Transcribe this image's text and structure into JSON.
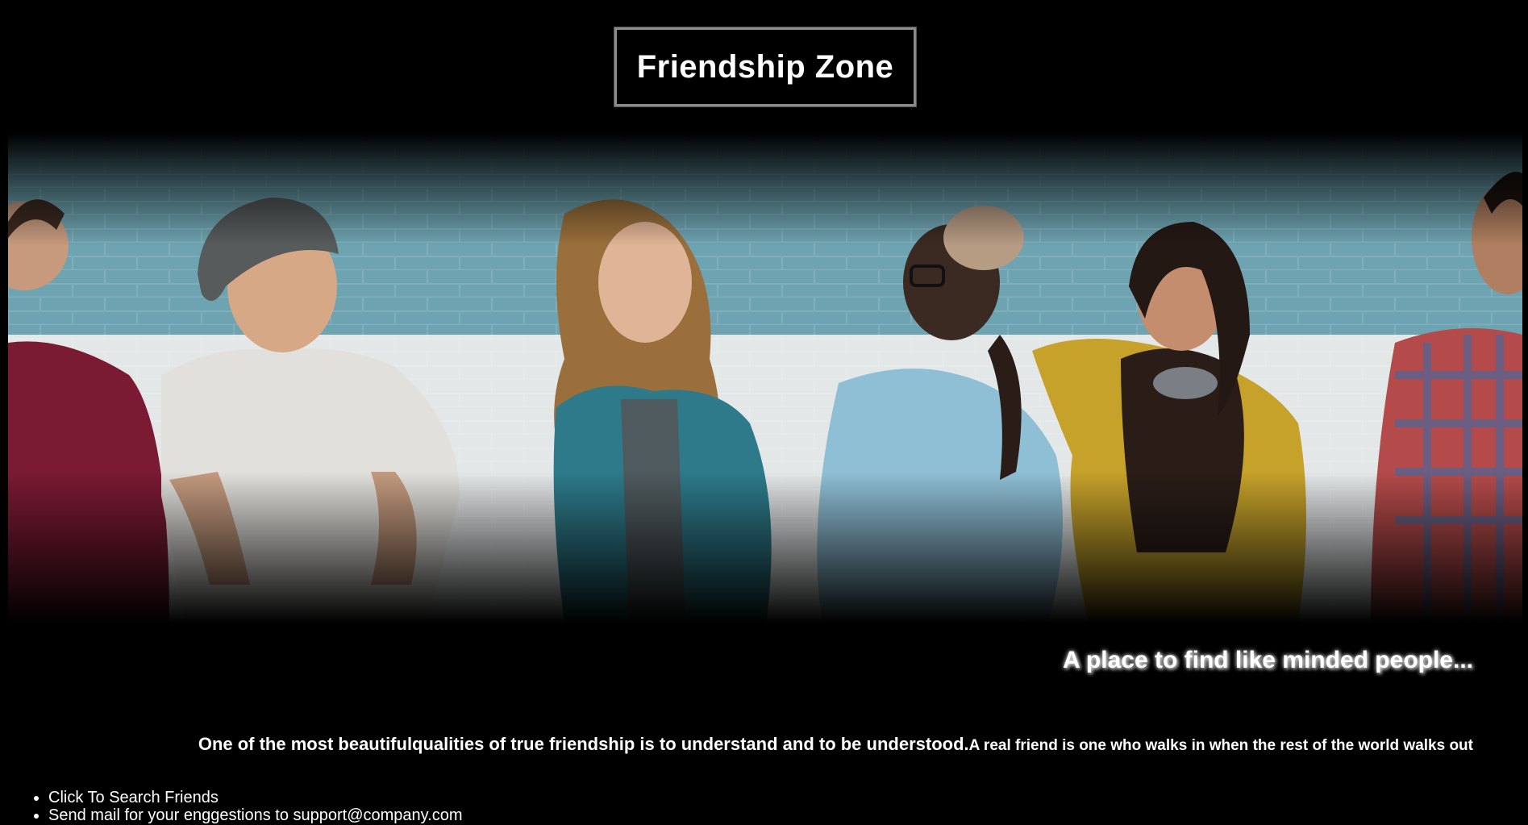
{
  "header": {
    "title": "Friendship Zone"
  },
  "hero": {
    "image_semantic": "group-of-friends-photo",
    "wall_colors": {
      "top": "#6ea3b1",
      "bottom": "#e4e7e8"
    }
  },
  "tagline": "A place to find like minded people...",
  "quote": {
    "main": "One of the most beautifulqualities of true friendship is to understand and to be understood.",
    "sub": "A real friend is one who walks in when the rest of the world walks out"
  },
  "links": {
    "search_friends": "Click To Search Friends",
    "mail_suggestions": "Send mail for your enggestions to support@company.com"
  }
}
